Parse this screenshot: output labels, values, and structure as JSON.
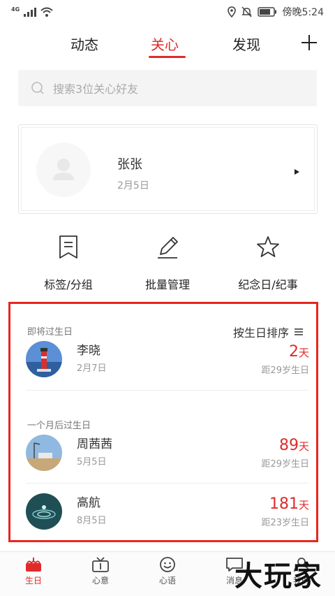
{
  "status_bar": {
    "network": "4G",
    "time": "傍晚5:24"
  },
  "top_nav": {
    "tabs": [
      {
        "label": "动态"
      },
      {
        "label": "关心"
      },
      {
        "label": "发现"
      }
    ],
    "active_index": 1
  },
  "search": {
    "placeholder": "搜索3位关心好友"
  },
  "profile": {
    "name": "张张",
    "date": "2月5日"
  },
  "actions": [
    {
      "label": "标签/分组",
      "icon": "bookmark-icon"
    },
    {
      "label": "批量管理",
      "icon": "pencil-icon"
    },
    {
      "label": "纪念日/纪事",
      "icon": "star-icon"
    }
  ],
  "birthday": {
    "upcoming_label": "即将过生日",
    "sort_label": "按生日排序",
    "later_label": "一个月后过生日",
    "upcoming": [
      {
        "name": "李晓",
        "date": "2月7日",
        "days": "2",
        "unit": "天",
        "distance": "距29岁生日"
      }
    ],
    "later": [
      {
        "name": "周茜茜",
        "date": "5月5日",
        "days": "89",
        "unit": "天",
        "distance": "距29岁生日"
      },
      {
        "name": "高航",
        "date": "8月5日",
        "days": "181",
        "unit": "天",
        "distance": "距23岁生日"
      }
    ]
  },
  "bottom_nav": [
    {
      "label": "生日",
      "icon": "cake-icon"
    },
    {
      "label": "心意",
      "icon": "gift-tv-icon"
    },
    {
      "label": "心语",
      "icon": "smile-icon"
    },
    {
      "label": "消息",
      "icon": "message-icon"
    },
    {
      "label": "我的",
      "icon": "user-icon"
    }
  ],
  "watermark": "大玩家",
  "colors": {
    "accent": "#e02b2b",
    "highlight_border": "#e8261e"
  }
}
